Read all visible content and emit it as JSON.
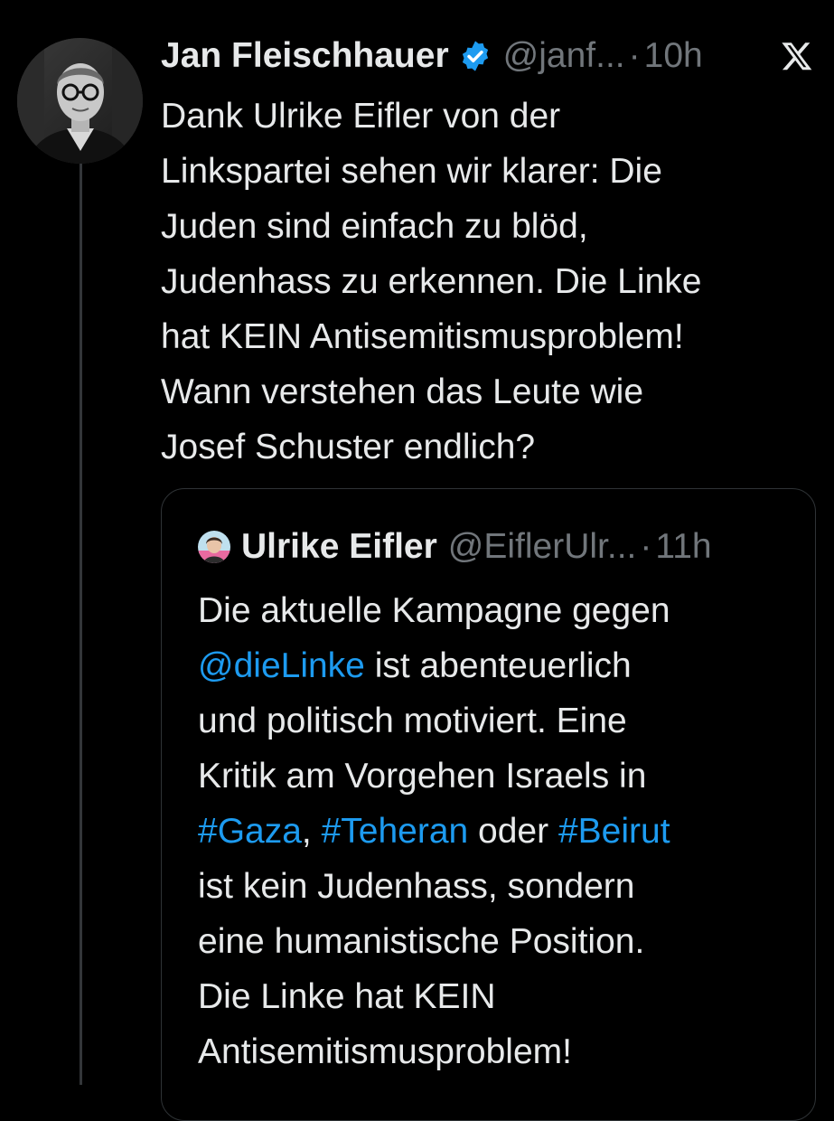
{
  "colors": {
    "background": "#000000",
    "text": "#e7e9ea",
    "muted": "#71767b",
    "link": "#1d9bf0",
    "border": "#2f3336"
  },
  "tweet": {
    "author_name": "Jan Fleischhauer",
    "verified_icon": "verified-badge-icon",
    "handle": "@janf...",
    "separator": "·",
    "time": "10h",
    "platform_icon": "x-logo-icon",
    "text_lines": [
      "Dank Ulrike Eifler von der",
      "Linkspartei sehen wir klarer: Die",
      "Juden sind einfach zu blöd,",
      "Judenhass zu erkennen. Die Linke",
      "hat KEIN Antisemitismusproblem!",
      "Wann verstehen das Leute wie",
      "Josef Schuster endlich?"
    ]
  },
  "quote": {
    "author_name": "Ulrike Eifler",
    "handle": "@EiflerUlr...",
    "separator": "·",
    "time": "11h",
    "line1": "Die aktuelle Kampagne gegen",
    "mention": "@dieLinke",
    "line2_rest": " ist abenteuerlich",
    "line3": "und politisch motiviert. Eine",
    "line4": "Kritik am Vorgehen Israels in",
    "hashtag1": "#Gaza",
    "comma": ", ",
    "hashtag2": "#Teheran",
    "oder": " oder ",
    "hashtag3": "#Beirut",
    "line6": "ist kein Judenhass, sondern",
    "line7": "eine humanistische Position.",
    "line8": "Die Linke hat KEIN",
    "line9": "Antisemitismusproblem!"
  }
}
